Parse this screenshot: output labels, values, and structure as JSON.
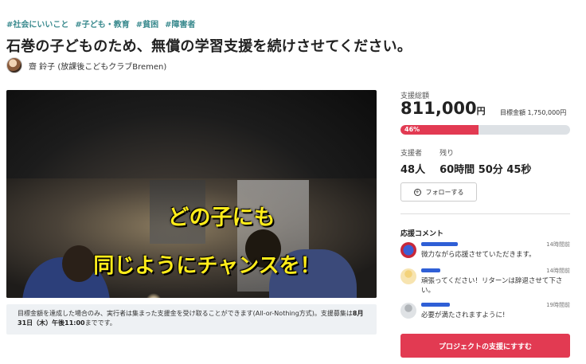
{
  "tags": [
    "#社会にいいこと",
    "#子ども・教育",
    "#貧困",
    "#障害者"
  ],
  "project": {
    "title": "石巻の子どものため、無償の学習支援を続けさせてください。",
    "owner": "齋 鈴子 (放課後こどもクラブBremen)"
  },
  "hero": {
    "line1": "どの子にも",
    "line2": "同じようにチャンスを！"
  },
  "notice": {
    "text_prefix": "目標金額を達成した場合のみ、実行者は集まった支援金を受け取ることができます(All-or-Nothing方式)。支援募集は",
    "deadline": "8月31日（木）午後11:00",
    "text_suffix": "までです。"
  },
  "funding": {
    "total_label": "支援総額",
    "amount": "811,000",
    "yen": "円",
    "goal_text": "目標金額 1,750,000円",
    "percent_text": "46%",
    "progress_fraction": 0.46
  },
  "stats": {
    "supporters_label": "支援者",
    "supporters_value": "48人",
    "remaining_label": "残り",
    "remaining_value": "60時間 50分 45秒"
  },
  "follow": {
    "label": "フォローする",
    "icon": "plus-circle-icon"
  },
  "comments": {
    "title": "応援コメント",
    "items": [
      {
        "time": "14時間前",
        "text": "微力ながら応援させていただきます。"
      },
      {
        "time": "14時間前",
        "text": "頑張ってください！リターンは辞退させて下さい。"
      },
      {
        "time": "19時間前",
        "text": "必要が満たされますように!"
      }
    ]
  },
  "cta": {
    "label": "プロジェクトの支援にすすむ"
  },
  "colors": {
    "accent": "#e23a52",
    "tag": "#3a8a8e",
    "progress_bg": "#dde1e5"
  }
}
